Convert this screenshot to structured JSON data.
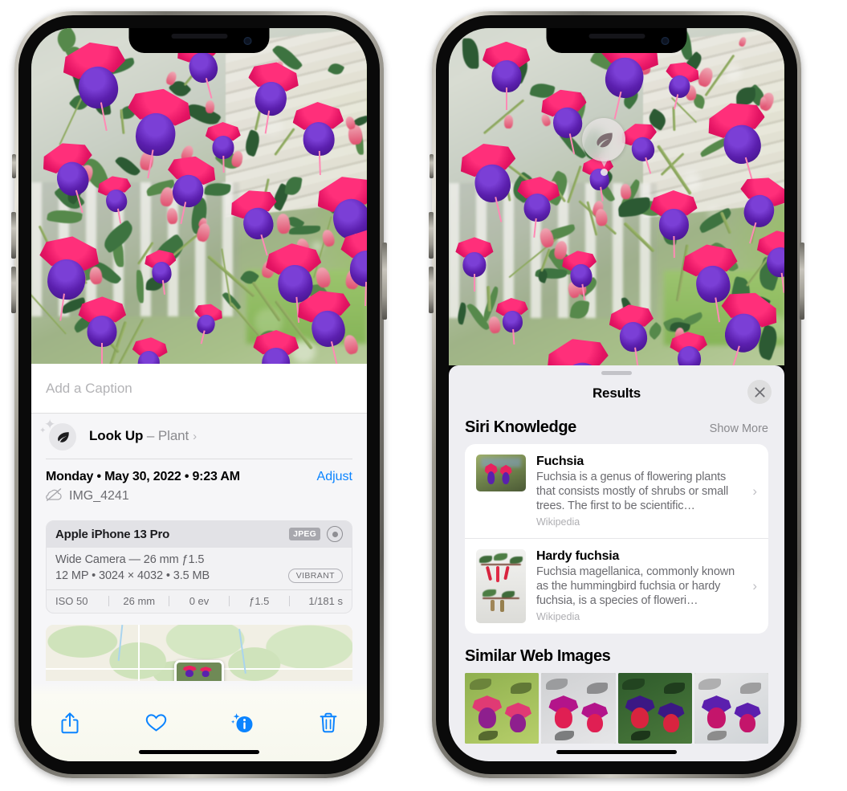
{
  "left_phone": {
    "photo_alt": "fuchsia-flowers-photo",
    "caption_field": {
      "placeholder": "Add a Caption",
      "value": ""
    },
    "look_up": {
      "icon": "leaf-icon",
      "label": "Look Up",
      "dash": "–",
      "subject": "Plant",
      "chevron": "›"
    },
    "meta": {
      "date": "Monday • May 30, 2022 • 9:23 AM",
      "adjust_label": "Adjust",
      "cloud_icon": "cloud-slash-icon",
      "filename": "IMG_4241"
    },
    "camera_card": {
      "device": "Apple iPhone 13 Pro",
      "format_tag": "JPEG",
      "raw_icon": "raw-badge-icon",
      "lens_line": "Wide Camera — 26 mm ƒ1.5",
      "specs_line": "12 MP • 3024 × 4032 • 3.5 MB",
      "style_tag": "VIBRANT",
      "exif": [
        "ISO 50",
        "26 mm",
        "0 ev",
        "ƒ1.5",
        "1/181 s"
      ]
    },
    "map": {
      "pin_label": "photo-location-pin"
    },
    "toolbar": [
      {
        "name": "share-icon",
        "label": "Share"
      },
      {
        "name": "heart-icon",
        "label": "Favorite"
      },
      {
        "name": "info-sparkle-icon",
        "label": "Info"
      },
      {
        "name": "trash-icon",
        "label": "Delete"
      }
    ]
  },
  "right_phone": {
    "badge": {
      "icon": "leaf-icon",
      "name": "visual-look-up-badge"
    },
    "sheet": {
      "title": "Results",
      "close_icon": "close-icon",
      "sections": [
        {
          "title": "Siri Knowledge",
          "action": "Show More",
          "items": [
            {
              "title": "Fuchsia",
              "description": "Fuchsia is a genus of flowering plants that consists mostly of shrubs or small trees. The first to be scientific…",
              "source": "Wikipedia",
              "chevron": "›"
            },
            {
              "title": "Hardy fuchsia",
              "description": "Fuchsia magellanica, commonly known as the hummingbird fuchsia or hardy fuchsia, is a species of floweri…",
              "source": "Wikipedia",
              "chevron": "›"
            }
          ]
        },
        {
          "title": "Similar Web Images",
          "thumbnails": [
            "web-image-1",
            "web-image-2",
            "web-image-3",
            "web-image-4"
          ]
        }
      ]
    }
  },
  "colors": {
    "accent_blue": "#0b84ff",
    "sheet_bg": "#eeeef2",
    "info_bg": "#f6f6f8",
    "card_bg": "#ffffff",
    "secondary_text": "#8a8a8e"
  }
}
